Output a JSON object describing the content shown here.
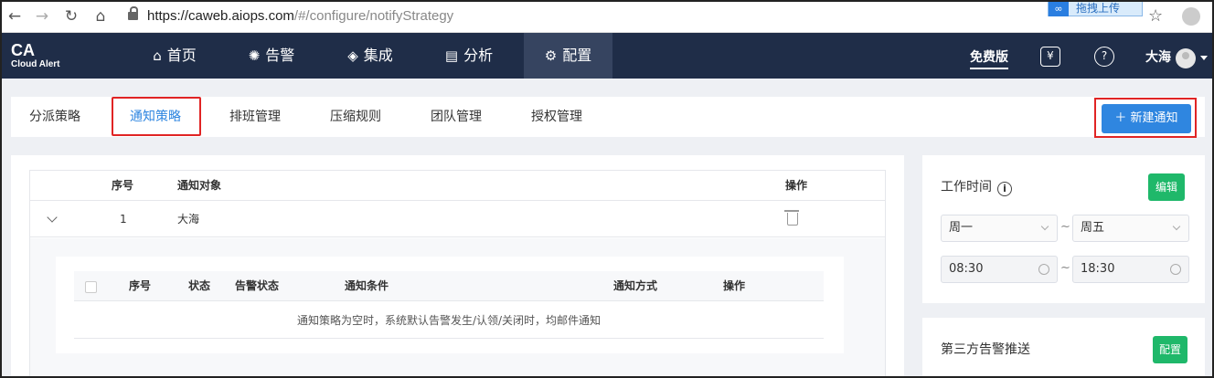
{
  "browser": {
    "url_host": "https://caweb.aiops.com",
    "url_path": "/#/configure/notifyStrategy",
    "extension_label": "拖拽上传"
  },
  "brand": {
    "title": "CA",
    "subtitle": "Cloud Alert"
  },
  "nav": [
    {
      "label": "首页",
      "icon": "home-icon"
    },
    {
      "label": "告警",
      "icon": "alarm-icon"
    },
    {
      "label": "集成",
      "icon": "layers-icon"
    },
    {
      "label": "分析",
      "icon": "chart-icon"
    },
    {
      "label": "配置",
      "icon": "gear-icon",
      "active": true
    }
  ],
  "header_right": {
    "plan": "免费版",
    "user": "大海"
  },
  "tabs": [
    {
      "label": "分派策略"
    },
    {
      "label": "通知策略",
      "active": true
    },
    {
      "label": "排班管理"
    },
    {
      "label": "压缩规则"
    },
    {
      "label": "团队管理"
    },
    {
      "label": "授权管理"
    }
  ],
  "new_button": "＋ 新建通知",
  "table": {
    "headers": {
      "index": "序号",
      "target": "通知对象",
      "ops": "操作"
    },
    "row": {
      "index": "1",
      "target": "大海"
    },
    "inner_headers": {
      "index": "序号",
      "status": "状态",
      "alert_status": "告警状态",
      "condition": "通知条件",
      "method": "通知方式",
      "ops": "操作"
    },
    "empty_message": "通知策略为空时，系统默认告警发生/认领/关闭时，均邮件通知"
  },
  "work_time": {
    "title": "工作时间",
    "edit": "编辑",
    "day_from": "周一",
    "day_to": "周五",
    "time_from": "08:30",
    "time_to": "18:30",
    "separator": "~"
  },
  "third_party": {
    "title": "第三方告警推送",
    "config": "配置"
  }
}
